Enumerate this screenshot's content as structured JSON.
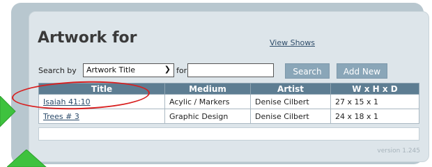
{
  "page": {
    "title": "Artwork for",
    "view_shows_link": "View Shows"
  },
  "search": {
    "label": "Search by",
    "field_selected": "Artwork Title",
    "for_label": "for",
    "query_value": "",
    "search_button": "Search",
    "add_new_button": "Add New"
  },
  "table": {
    "columns": [
      "Title",
      "Medium",
      "Artist",
      "W x H x D"
    ],
    "rows": [
      {
        "title": "Isaiah 41:10",
        "medium": "Acylic / Markers",
        "artist": "Denise Cilbert",
        "dims": "27 x 15 x 1"
      },
      {
        "title": "Trees # 3",
        "medium": "Graphic Design",
        "artist": "Denise Cilbert",
        "dims": "24 x 18 x 1"
      }
    ]
  },
  "footer": {
    "version": "version 1.245"
  },
  "colors": {
    "header_bg": "#5d7d92",
    "button_bg": "#8aa6b8",
    "annotation_circle": "#d81f1f",
    "annotation_arrow": "#3ec23e"
  }
}
